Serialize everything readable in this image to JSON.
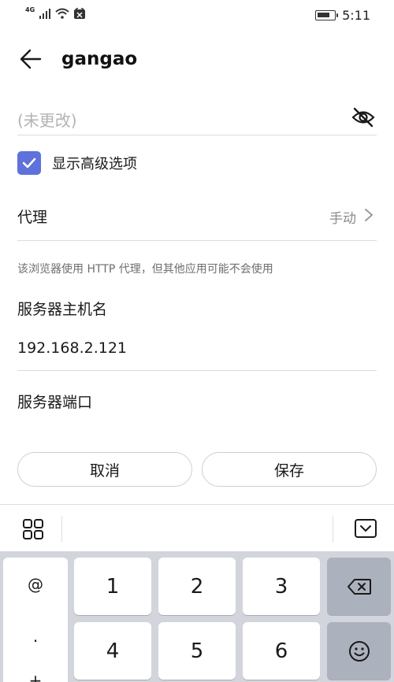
{
  "status_bar": {
    "network": "4G",
    "time": "5:11"
  },
  "header": {
    "title": "gangao"
  },
  "form": {
    "password_placeholder": "(未更改)",
    "advanced_label": "显示高级选项",
    "advanced_checked": true,
    "proxy_label": "代理",
    "proxy_value": "手动",
    "hint": "该浏览器使用 HTTP 代理，但其他应用可能不会使用",
    "host_label": "服务器主机名",
    "host_value": "192.168.2.121",
    "port_label": "服务器端口"
  },
  "buttons": {
    "cancel": "取消",
    "save": "保存"
  },
  "keyboard": {
    "symbols": [
      "@",
      ".",
      "+"
    ],
    "keys_row1": [
      "1",
      "2",
      "3"
    ],
    "keys_row2": [
      "4",
      "5",
      "6"
    ]
  },
  "colors": {
    "accent": "#5f71db",
    "keyboard_bg": "#d2d5db",
    "dark_key": "#acb2bd"
  }
}
